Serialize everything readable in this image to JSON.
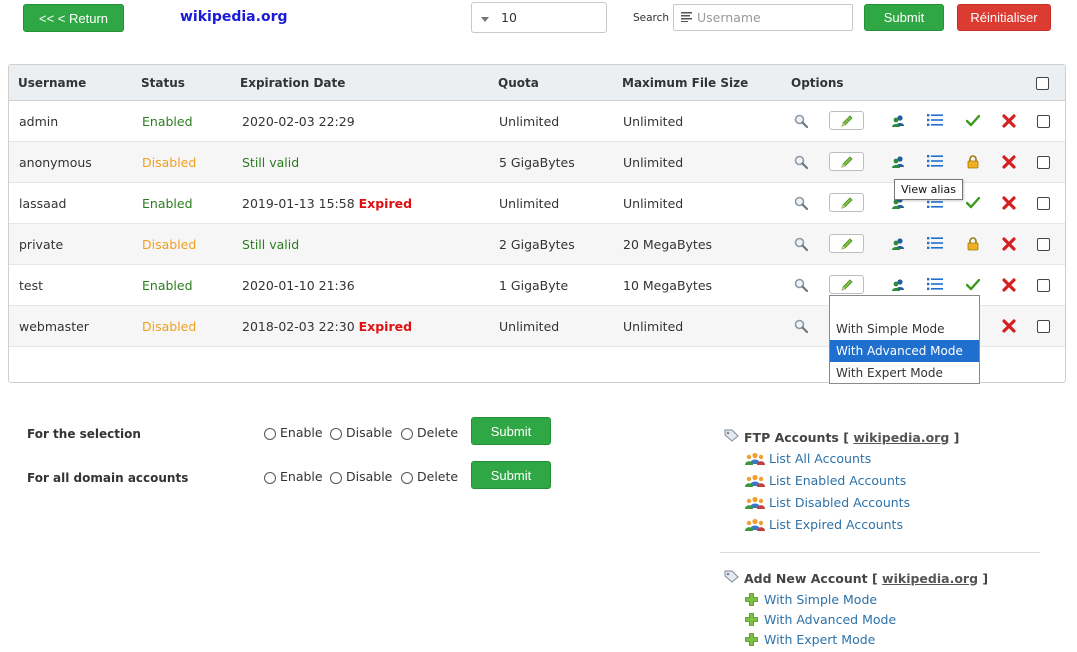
{
  "topbar": {
    "return_label": "<< < Return",
    "domain": "wikipedia.org",
    "page_size_value": "10",
    "search_label": "Search",
    "username_placeholder": "Username",
    "submit_label": "Submit",
    "reset_label": "Réinitialiser"
  },
  "table": {
    "headers": {
      "username": "Username",
      "status": "Status",
      "expiration": "Expiration Date",
      "quota": "Quota",
      "max_file_size": "Maximum File Size",
      "options": "Options"
    },
    "rows": [
      {
        "username": "admin",
        "status": "Enabled",
        "status_kind": "enabled",
        "expiration": "2020-02-03 22:29",
        "expired": "",
        "quota": "Unlimited",
        "max_file_size": "Unlimited",
        "lock_icon": "check-icon"
      },
      {
        "username": "anonymous",
        "status": "Disabled",
        "status_kind": "disabled",
        "expiration": "Still valid",
        "expired": "",
        "quota": "5 GigaBytes",
        "max_file_size": "Unlimited",
        "lock_icon": "lock-icon"
      },
      {
        "username": "lassaad",
        "status": "Enabled",
        "status_kind": "enabled",
        "expiration": "2019-01-13 15:58",
        "expired": "Expired",
        "quota": "Unlimited",
        "max_file_size": "Unlimited",
        "lock_icon": "check-icon"
      },
      {
        "username": "private",
        "status": "Disabled",
        "status_kind": "disabled",
        "expiration": "Still valid",
        "expired": "",
        "quota": "2 GigaBytes",
        "max_file_size": "20 MegaBytes",
        "lock_icon": "lock-icon"
      },
      {
        "username": "test",
        "status": "Enabled",
        "status_kind": "enabled",
        "expiration": "2020-01-10 21:36",
        "expired": "",
        "quota": "1 GigaByte",
        "max_file_size": "10 MegaBytes",
        "lock_icon": "check-icon"
      },
      {
        "username": "webmaster",
        "status": "Disabled",
        "status_kind": "disabled",
        "expiration": "2018-02-03 22:30",
        "expired": "Expired",
        "quota": "Unlimited",
        "max_file_size": "Unlimited",
        "lock_icon": "lock-icon"
      }
    ],
    "tooltip": "View alias",
    "edit_dropdown": [
      "With Simple Mode",
      "With Advanced Mode",
      "With Expert Mode"
    ],
    "edit_dropdown_selected": "With Advanced Mode"
  },
  "bulk": {
    "selection_label": "For the selection",
    "all_label": "For all domain accounts",
    "enable": "Enable",
    "disable": "Disable",
    "delete": "Delete",
    "submit": "Submit"
  },
  "sidebar": {
    "ftp_title": "FTP Accounts [",
    "ftp_domain": "wikipedia.org",
    "ftp_close": "]",
    "ftp_links": [
      "List All Accounts",
      "List Enabled Accounts",
      "List Disabled Accounts",
      "List Expired Accounts"
    ],
    "add_title": "Add New Account [",
    "add_domain": "wikipedia.org",
    "add_close": "]",
    "add_links": [
      "With Simple Mode",
      "With Advanced Mode",
      "With Expert Mode"
    ]
  },
  "colors": {
    "green": "#2fa745",
    "red": "#dc3b32",
    "enabled": "#2a7d1e",
    "disabled": "#f0a020",
    "expired": "#e01010",
    "link": "#2c72a8",
    "logo": "#1a1ad8"
  }
}
